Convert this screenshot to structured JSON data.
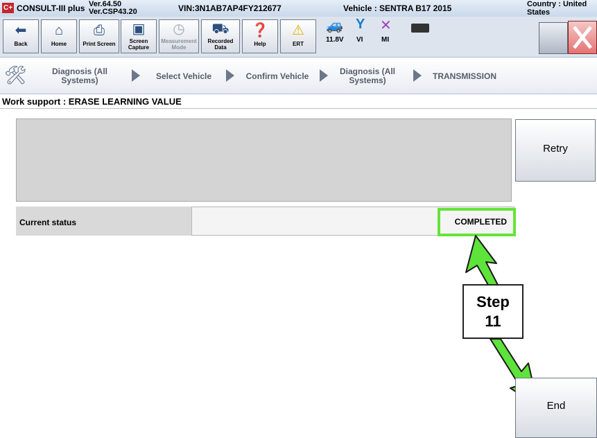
{
  "titlebar": {
    "logo": "C+",
    "app_name": "CONSULT-III plus",
    "version_line1": "Ver.64.50",
    "version_line2": "Ver.CSP43.20",
    "vin": "VIN:3N1AB7AP4FY212677",
    "vehicle": "Vehicle : SENTRA B17 2015",
    "country": "Country : United States"
  },
  "toolbar": {
    "back": "Back",
    "home": "Home",
    "print_screen": "Print Screen",
    "screen_capture": "Screen Capture",
    "measurement_mode": "Measurement Mode",
    "recorded_data": "Recorded Data",
    "help": "Help",
    "ert": "ERT",
    "voltage": "11.8V",
    "vi": "VI",
    "mi": "MI"
  },
  "breadcrumb": {
    "item1": "Diagnosis (All Systems)",
    "item2": "Select Vehicle",
    "item3": "Confirm Vehicle",
    "item4": "Diagnosis (All Systems)",
    "item5": "TRANSMISSION"
  },
  "work_support": {
    "title": "Work support : ERASE LEARNING VALUE"
  },
  "content": {
    "retry_label": "Retry",
    "status_label": "Current status",
    "status_value": "COMPLETED",
    "end_label": "End"
  },
  "annotation": {
    "step_line1": "Step",
    "step_line2": "11",
    "highlight_color": "#66e339",
    "arrow_color": "#5ee33a"
  }
}
